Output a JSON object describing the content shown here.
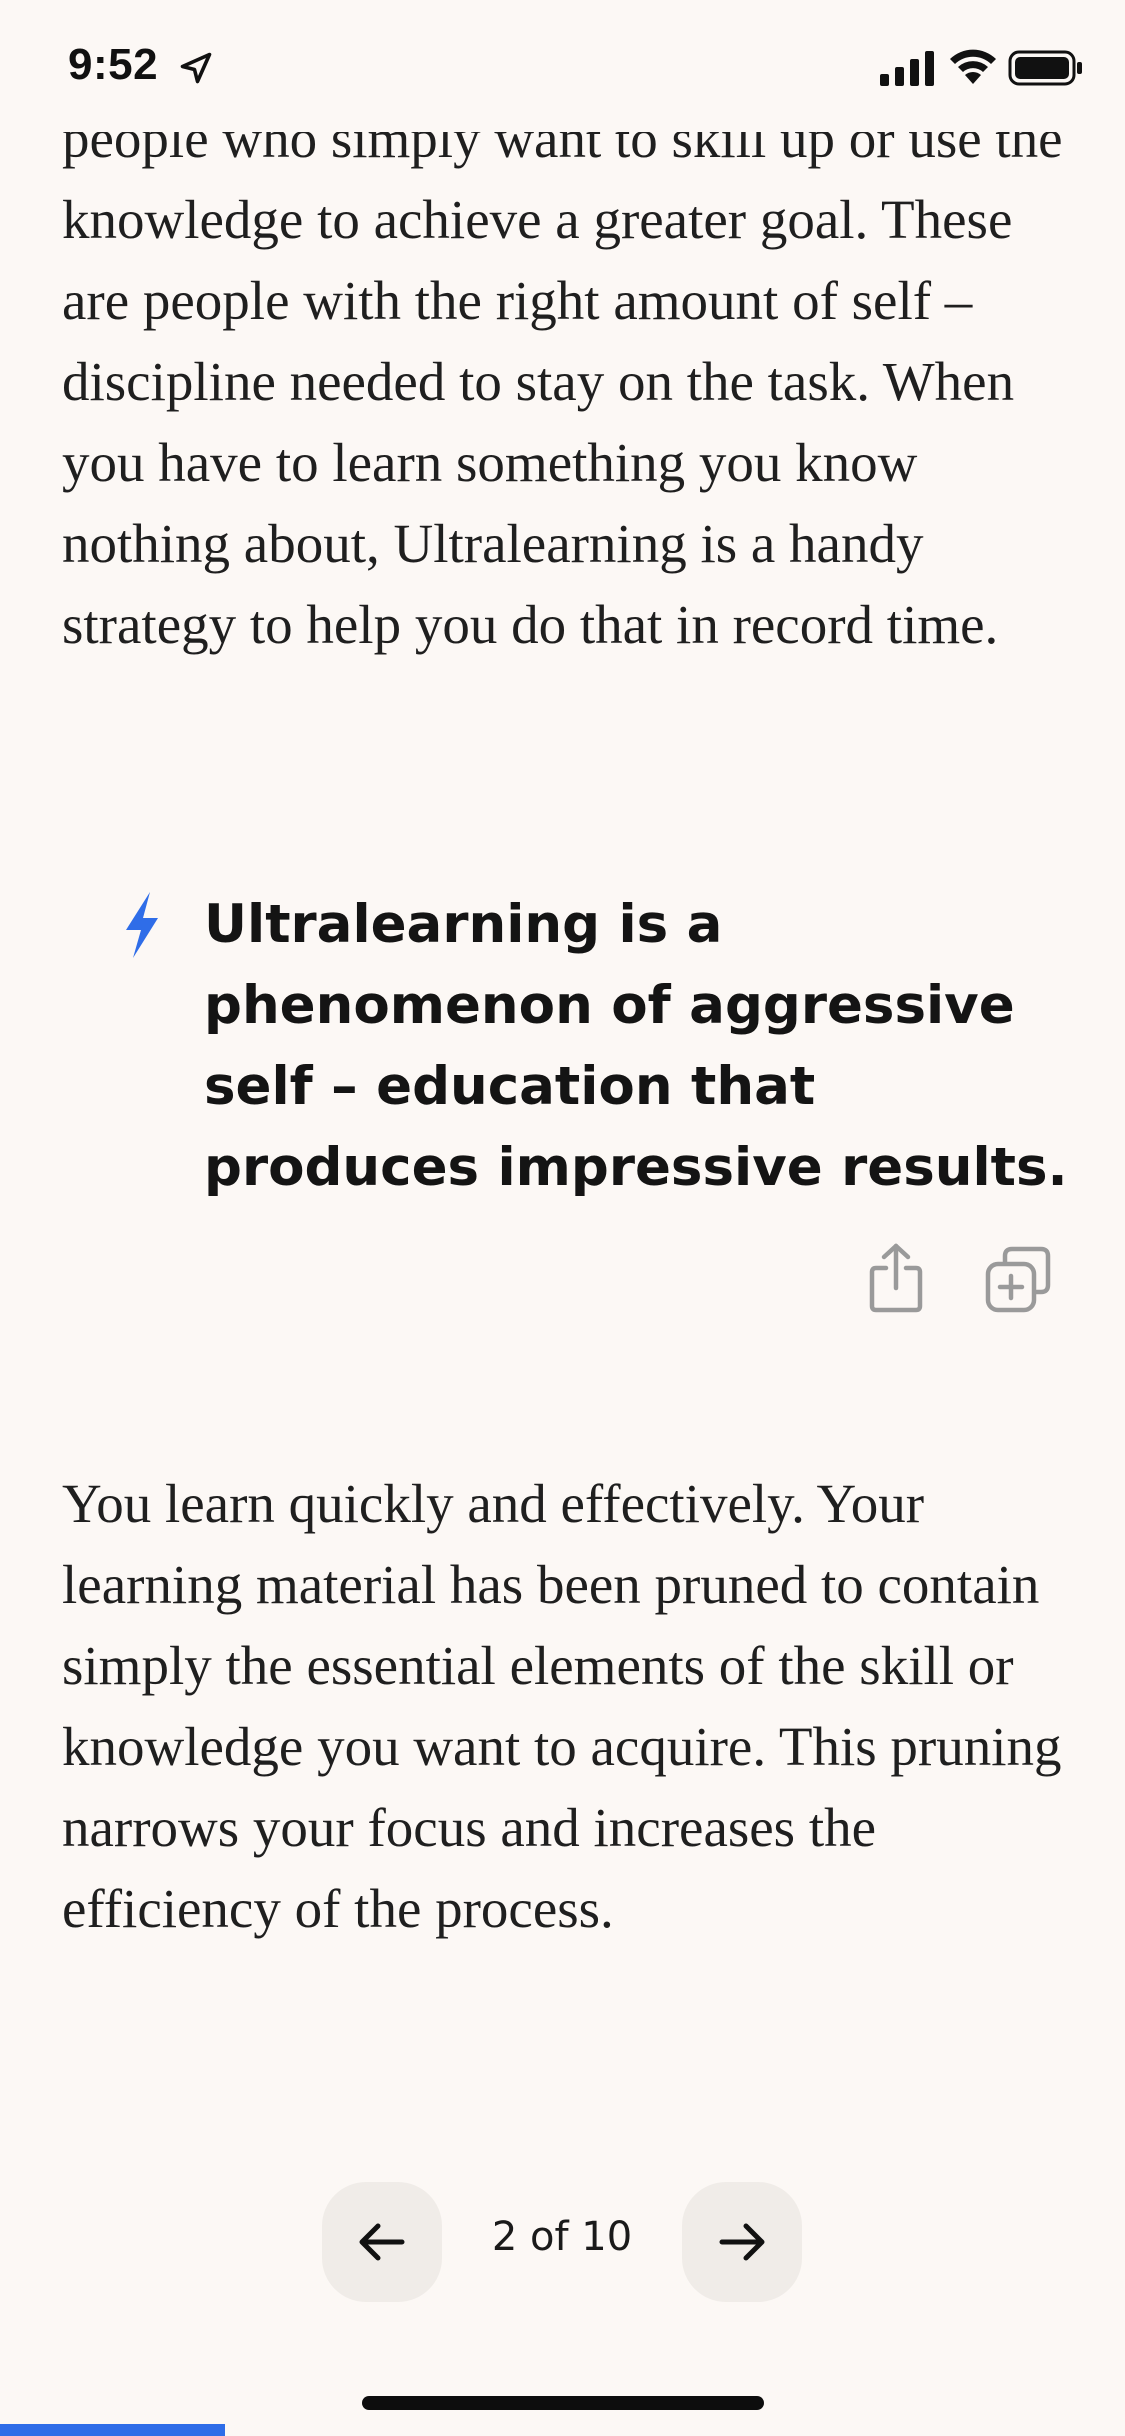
{
  "status_bar": {
    "time": "9:52"
  },
  "content": {
    "paragraph_top": "people who simply want to skill up or use the knowledge to achieve a greater goal. These are people with the right amount of self – discipline needed to stay on the task. When you have to learn something you know nothing about, Ultralearning is a handy strategy to help you do that in record time.",
    "highlight": "Ultralearning is a phenomenon of aggressive self – education that produces impressive results.",
    "paragraph_bottom": "You learn quickly and effectively. Your learning material has been pruned to contain simply the essential elements of the skill or knowledge you want to acquire. This pruning narrows your focus and increases the efficiency of the process."
  },
  "pager": {
    "label": "2 of 10",
    "current": 2,
    "total": 10
  },
  "colors": {
    "accent": "#2f6de8",
    "background": "#fcf8f5"
  },
  "icons": {
    "highlight": "bolt-icon",
    "share": "share-icon",
    "add": "add-to-collection-icon",
    "previous": "arrow-left-icon",
    "next": "arrow-right-icon"
  }
}
